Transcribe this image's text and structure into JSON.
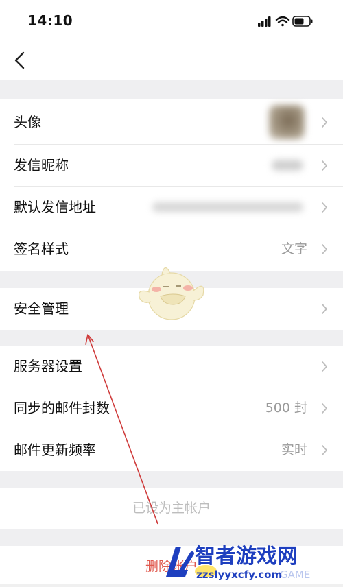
{
  "status_bar": {
    "time": "14:10"
  },
  "group1": {
    "avatar_label": "头像",
    "nickname_label": "发信昵称",
    "address_label": "默认发信地址",
    "signature_label": "签名样式",
    "signature_value": "文字"
  },
  "group2": {
    "security_label": "安全管理"
  },
  "group3": {
    "server_label": "服务器设置",
    "sync_label": "同步的邮件封数",
    "sync_value": "500 封",
    "update_label": "邮件更新频率",
    "update_value": "实时"
  },
  "primary_account_text": "已设为主帐户",
  "delete_account_text": "删除帐户",
  "watermark": {
    "brand": "智者游戏网",
    "url": "zzslyyxcfy.com",
    "game": "GAME"
  },
  "colors": {
    "background": "#efeff1",
    "danger": "#e05a4f",
    "annotation_arrow": "#cf3b3b",
    "muted": "#9a9a9a"
  }
}
